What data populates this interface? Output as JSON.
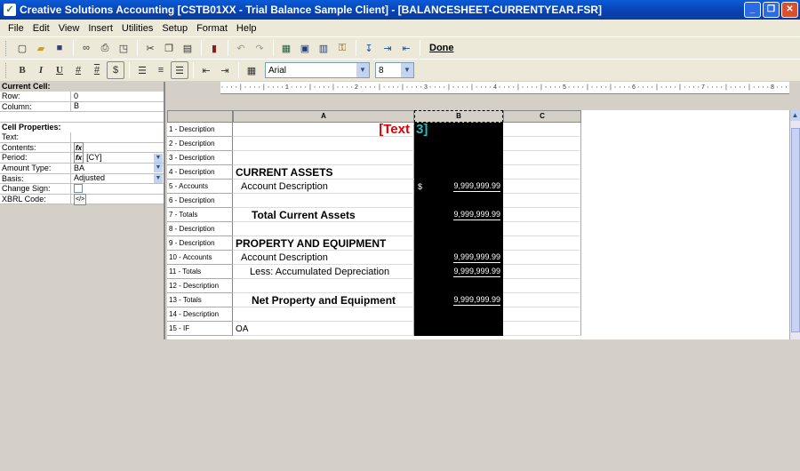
{
  "window": {
    "title": "Creative Solutions Accounting [CSTB01XX - Trial Balance Sample Client] - [BALANCESHEET-CURRENTYEAR.FSR]"
  },
  "menu": [
    "File",
    "Edit",
    "View",
    "Insert",
    "Utilities",
    "Setup",
    "Format",
    "Help"
  ],
  "toolbar": {
    "done_label": "Done",
    "font": "Arial",
    "size": "8",
    "bold": "B",
    "italic": "I",
    "underline": "U",
    "hash1": "#",
    "hash2": "#",
    "dollar": "$"
  },
  "panel": {
    "current_cell_title": "Current Cell:",
    "row_label": "Row:",
    "row_value": "0",
    "column_label": "Column:",
    "column_value": "B",
    "cell_props_title": "Cell Properties:",
    "text_label": "Text:",
    "contents_label": "Contents:",
    "period_label": "Period:",
    "period_value": "[CY]",
    "amount_type_label": "Amount Type:",
    "amount_type_value": "BA",
    "basis_label": "Basis:",
    "basis_value": "Adjusted",
    "change_sign_label": "Change Sign:",
    "xbrl_label": "XBRL Code:"
  },
  "columns": [
    "A",
    "B",
    "C"
  ],
  "rows": [
    {
      "head": "1 - Description",
      "a": "",
      "b": "",
      "style": "title"
    },
    {
      "head": "2 - Description",
      "a": "",
      "b": ""
    },
    {
      "head": "3 - Description",
      "a": "",
      "b": ""
    },
    {
      "head": "4 - Description",
      "a": "CURRENT ASSETS",
      "b": "",
      "style": "section"
    },
    {
      "head": "5 - Accounts",
      "a": "Account Description",
      "b": "9,999,999.99",
      "dollar": "$",
      "style": "acct"
    },
    {
      "head": "6 - Description",
      "a": "",
      "b": ""
    },
    {
      "head": "7 - Totals",
      "a": "Total Current Assets",
      "b": "9,999,999.99",
      "style": "total"
    },
    {
      "head": "8 - Description",
      "a": "",
      "b": ""
    },
    {
      "head": "9 - Description",
      "a": "PROPERTY AND EQUIPMENT",
      "b": "",
      "style": "section"
    },
    {
      "head": "10 - Accounts",
      "a": "Account Description",
      "b": "9,999,999.99",
      "style": "acct"
    },
    {
      "head": "11 - Totals",
      "a": "Less: Accumulated Depreciation",
      "b": "9,999,999.99",
      "style": "sub"
    },
    {
      "head": "12 - Description",
      "a": "",
      "b": ""
    },
    {
      "head": "13 - Totals",
      "a": "Net Property and Equipment",
      "b": "9,999,999.99",
      "style": "total"
    },
    {
      "head": "14 - Description",
      "a": "",
      "b": ""
    },
    {
      "head": "15 - IF",
      "a": "OA",
      "b": "",
      "style": "if"
    }
  ],
  "title_cell": {
    "a_part": "[Text",
    "b_part": "3]",
    "a_color": "#e00000",
    "b_color": "#20c0c0"
  },
  "ruler_text": "····|····|····1····|····|····2····|····|····3····|····|····4····|····|····5····|····|····6····|····|····7····|····|····8····|····|····9····|····|····"
}
